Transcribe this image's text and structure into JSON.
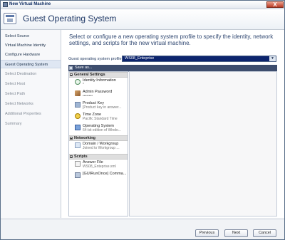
{
  "window": {
    "title": "New Virtual Machine",
    "close_label": "X"
  },
  "header": {
    "title": "Guest Operating System"
  },
  "nav": {
    "items": [
      {
        "label": "Select Source",
        "state": "normal"
      },
      {
        "label": "Virtual Machine Identity",
        "state": "normal"
      },
      {
        "label": "Configure Hardware",
        "state": "normal"
      },
      {
        "label": "Guest Operating System",
        "state": "active"
      },
      {
        "label": "Select Destination",
        "state": "disabled"
      },
      {
        "label": "Select Host",
        "state": "disabled"
      },
      {
        "label": "Select Path",
        "state": "disabled"
      },
      {
        "label": "Select Networks",
        "state": "disabled"
      },
      {
        "label": "Additional Properties",
        "state": "disabled"
      },
      {
        "label": "Summary",
        "state": "disabled"
      }
    ]
  },
  "main": {
    "description": "Select or configure a new operating system profile to specify the identity, network settings, and scripts for the new virtual machine.",
    "profile_label": "Guest operating system profile:",
    "profile_value": "WS08_Enteprise",
    "toolbar": {
      "save_label": "Save as..."
    },
    "sections": [
      {
        "title": "General Settings"
      },
      {
        "title": "Networking"
      },
      {
        "title": "Scripts"
      }
    ],
    "items": [
      {
        "label": "Identity Information",
        "sub": "*",
        "icon": "identity-icon"
      },
      {
        "label": "Admin Password",
        "sub": "••••••••",
        "icon": "password-icon"
      },
      {
        "label": "Product Key",
        "sub": "[Product key in answer...",
        "icon": "product-key-icon"
      },
      {
        "label": "Time Zone",
        "sub": "Pacific Standard Time",
        "icon": "time-zone-icon"
      },
      {
        "label": "Operating System",
        "sub": "64-bit edition of Windo...",
        "icon": "operating-system-icon"
      },
      {
        "label": "Domain / Workgroup",
        "sub": "Joined to Workgroup ...",
        "icon": "domain-icon"
      },
      {
        "label": "Answer File",
        "sub": "WS08_Enteprise.xml",
        "icon": "answer-file-icon"
      },
      {
        "label": "[GUIRunOnce] Comma...",
        "sub": "",
        "icon": "run-once-icon"
      }
    ]
  },
  "footer": {
    "previous_label": "Previous",
    "next_label": "Next",
    "cancel_label": "Cancel"
  },
  "colors": {
    "accent": "#0c246d",
    "title": "#1e3765"
  }
}
